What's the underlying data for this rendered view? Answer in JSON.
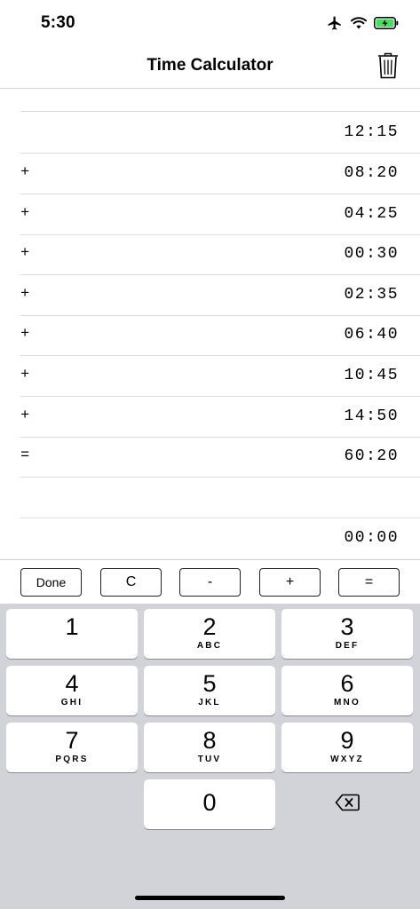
{
  "status": {
    "time": "5:30"
  },
  "nav": {
    "title": "Time Calculator"
  },
  "rows": [
    {
      "op": "",
      "value": ""
    },
    {
      "op": "",
      "value": "12:15"
    },
    {
      "op": "+",
      "value": "08:20"
    },
    {
      "op": "+",
      "value": "04:25"
    },
    {
      "op": "+",
      "value": "00:30"
    },
    {
      "op": "+",
      "value": "02:35"
    },
    {
      "op": "+",
      "value": "06:40"
    },
    {
      "op": "+",
      "value": "10:45"
    },
    {
      "op": "+",
      "value": "14:50"
    },
    {
      "op": "=",
      "value": "60:20"
    },
    {
      "op": "",
      "value": ""
    },
    {
      "op": "",
      "value": "00:00"
    }
  ],
  "toolbar": {
    "done": "Done",
    "clear": "C",
    "minus": "-",
    "plus": "+",
    "equals": "="
  },
  "keypad": {
    "keys": [
      {
        "num": "1",
        "letters": ""
      },
      {
        "num": "2",
        "letters": "ABC"
      },
      {
        "num": "3",
        "letters": "DEF"
      },
      {
        "num": "4",
        "letters": "GHI"
      },
      {
        "num": "5",
        "letters": "JKL"
      },
      {
        "num": "6",
        "letters": "MNO"
      },
      {
        "num": "7",
        "letters": "PQRS"
      },
      {
        "num": "8",
        "letters": "TUV"
      },
      {
        "num": "9",
        "letters": "WXYZ"
      },
      {
        "num": "0",
        "letters": ""
      }
    ],
    "backspace_icon": "backspace-icon"
  },
  "colors": {
    "keypad_bg": "#d1d3d9",
    "battery_green": "#4cd964"
  }
}
